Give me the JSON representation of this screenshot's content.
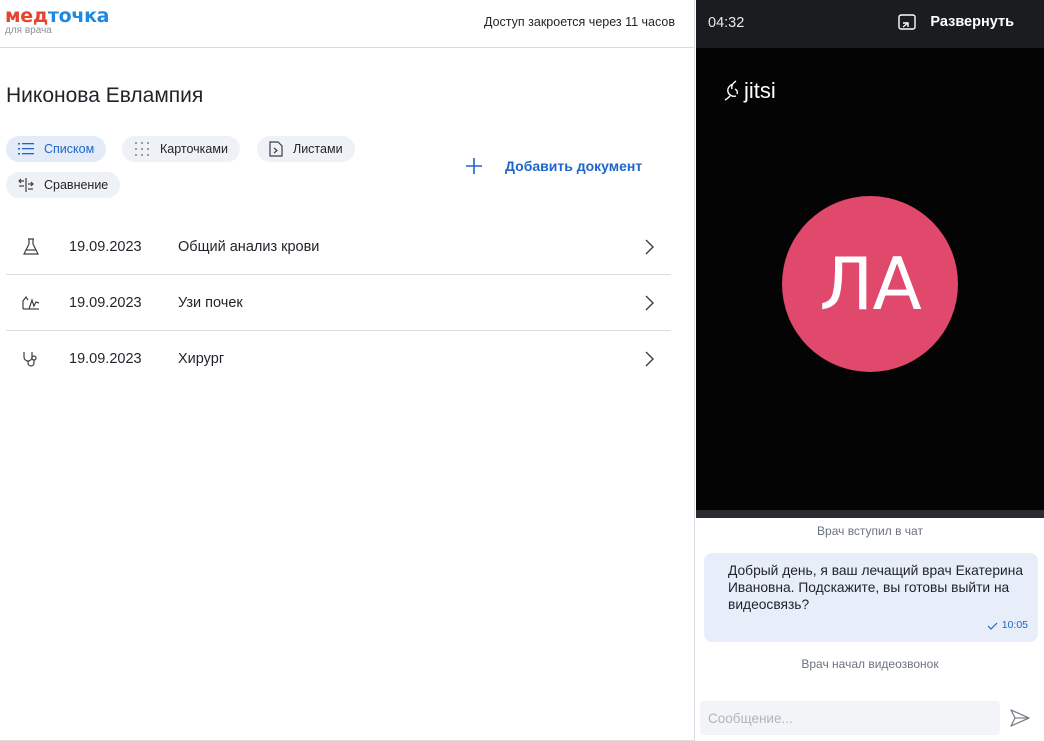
{
  "header": {
    "brand_part1": "мед",
    "brand_part2": "точка",
    "brand_sub": "для врача",
    "access_notice": "Доступ закроется через 11 часов"
  },
  "patient": {
    "name": "Никонова Евлампия"
  },
  "view_modes": [
    {
      "label": "Списком",
      "icon": "list-icon",
      "active": true
    },
    {
      "label": "Карточками",
      "icon": "grid-dots-icon",
      "active": false
    },
    {
      "label": "Листами",
      "icon": "document-icon",
      "active": false
    },
    {
      "label": "Сравнение",
      "icon": "compare-icon",
      "active": false
    }
  ],
  "add_document_label": "Добавить документ",
  "documents": [
    {
      "date": "19.09.2023",
      "title": "Общий анализ крови",
      "icon": "flask-icon"
    },
    {
      "date": "19.09.2023",
      "title": "Узи почек",
      "icon": "ultrasound-icon"
    },
    {
      "date": "19.09.2023",
      "title": "Хирург",
      "icon": "stethoscope-icon"
    }
  ],
  "call": {
    "timer": "04:32",
    "expand_label": "Развернуть",
    "provider": "jitsi",
    "avatar_initials": "ЛА",
    "avatar_color": "#e0486c"
  },
  "chat": {
    "system_joined": "Врач вступил в чат",
    "message_text": "Добрый день, я ваш лечащий врач Екатерина Ивановна. Подскажите, вы готовы выйти на видеосвязь?",
    "message_time": "10:05",
    "system_call_started": "Врач начал видеозвонок",
    "input_placeholder": "Сообщение..."
  },
  "colors": {
    "accent": "#1e66c8",
    "brand_red": "#e8432c",
    "brand_blue": "#1e88e5"
  }
}
